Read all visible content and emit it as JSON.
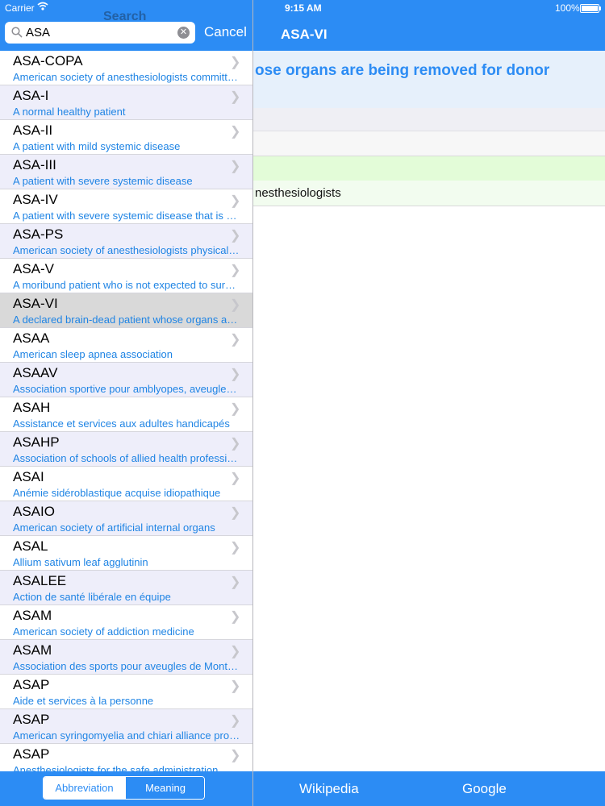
{
  "status": {
    "carrier": "Carrier",
    "time": "9:15 AM",
    "battery": "100%"
  },
  "detail": {
    "title": "ASA-VI",
    "meaning": "ose organs are being removed for donor",
    "source": "nesthesiologists",
    "tabs": {
      "wikipedia": "Wikipedia",
      "google": "Google"
    }
  },
  "search": {
    "ghost_title": "Search",
    "query": "ASA",
    "cancel_label": "Cancel",
    "segments": {
      "abbreviation": "Abbreviation",
      "meaning": "Meaning"
    }
  },
  "colors": {
    "accent": "#2c8cf4",
    "description": "#1f84e4",
    "alt_row": "#eeeefa",
    "selected_row": "#d9d9d9"
  },
  "results": [
    {
      "abbr": "ASA-COPA",
      "desc": "American society of anesthesiologists committee on practice..."
    },
    {
      "abbr": "ASA-I",
      "desc": "A normal healthy patient"
    },
    {
      "abbr": "ASA-II",
      "desc": "A patient with mild systemic disease"
    },
    {
      "abbr": "ASA-III",
      "desc": "A patient with severe systemic disease"
    },
    {
      "abbr": "ASA-IV",
      "desc": "A patient with severe systemic disease that is a constant threat to life"
    },
    {
      "abbr": "ASA-PS",
      "desc": "American society of anesthesiologists physical status"
    },
    {
      "abbr": "ASA-V",
      "desc": "A moribund patient who is not expected to survive"
    },
    {
      "abbr": "ASA-VI",
      "desc": "A declared brain-dead patient whose organs are being removed",
      "selected": true
    },
    {
      "abbr": "ASAA",
      "desc": "American sleep apnea association"
    },
    {
      "abbr": "ASAAV",
      "desc": "Association sportive pour amblyopes, aveugles et voyants"
    },
    {
      "abbr": "ASAH",
      "desc": "Assistance et services aux adultes handicapés"
    },
    {
      "abbr": "ASAHP",
      "desc": "Association of schools of allied health professions"
    },
    {
      "abbr": "ASAI",
      "desc": "Anémie sidéroblastique acquise idiopathique"
    },
    {
      "abbr": "ASAIO",
      "desc": "American society of artificial internal organs"
    },
    {
      "abbr": "ASAL",
      "desc": "Allium sativum leaf agglutinin"
    },
    {
      "abbr": "ASALEE",
      "desc": "Action de santé libérale en équipe"
    },
    {
      "abbr": "ASAM",
      "desc": "American society of addiction medicine"
    },
    {
      "abbr": "ASAM",
      "desc": "Association des sports pour aveugles de Montréal"
    },
    {
      "abbr": "ASAP",
      "desc": "Aide et services à la personne"
    },
    {
      "abbr": "ASAP",
      "desc": "American syringomyelia and chiari alliance project"
    },
    {
      "abbr": "ASAP",
      "desc": "Anesthesiologists for the safe administration"
    }
  ]
}
